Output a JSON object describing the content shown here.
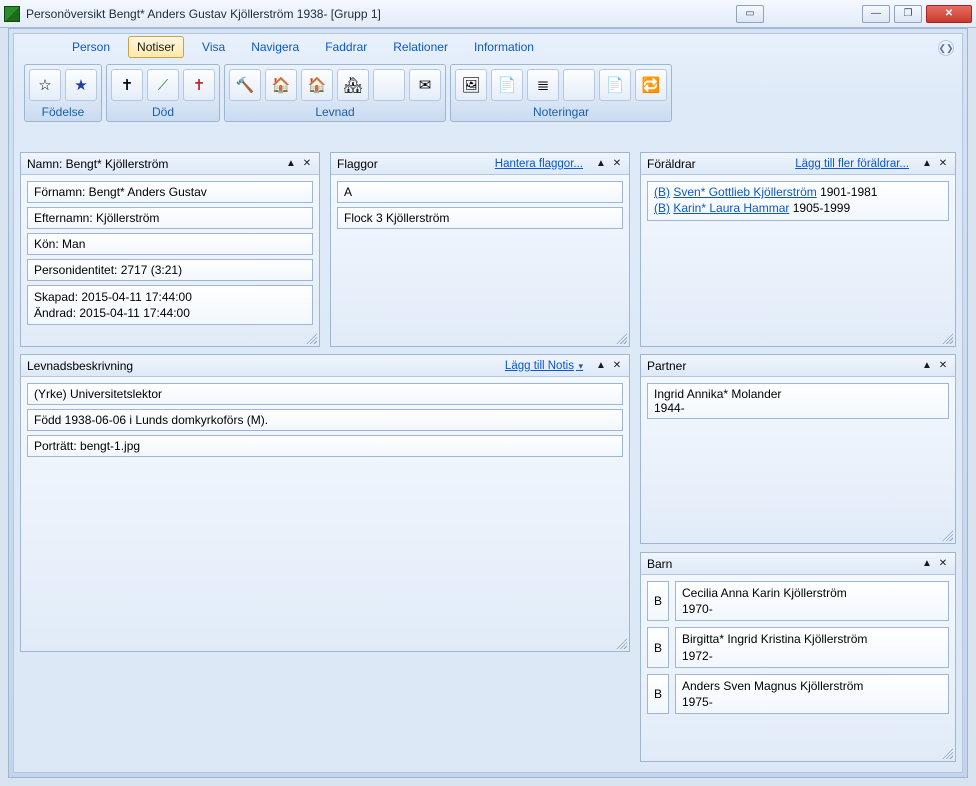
{
  "window": {
    "title": "Personöversikt Bengt* Anders Gustav Kjöllerström 1938- [Grupp 1]"
  },
  "menu": {
    "items": [
      "Person",
      "Notiser",
      "Visa",
      "Navigera",
      "Faddrar",
      "Relationer",
      "Information"
    ],
    "active_index": 1
  },
  "ribbon": {
    "groups": [
      {
        "label": "Födelse",
        "icons": [
          "star-outline",
          "star-filled"
        ]
      },
      {
        "label": "Död",
        "icons": [
          "cross",
          "wand",
          "cross-mark"
        ]
      },
      {
        "label": "Levnad",
        "icons": [
          "hammer",
          "house-flag",
          "house-red",
          "houses",
          "blank",
          "mail"
        ]
      },
      {
        "label": "Noteringar",
        "icons": [
          "image",
          "page",
          "lines",
          "blank",
          "page-red",
          "swap"
        ]
      }
    ]
  },
  "panels": {
    "name": {
      "title": "Namn: Bengt* Kjöllerström",
      "fields": {
        "fornamn": "Förnamn: Bengt* Anders Gustav",
        "efternamn": "Efternamn: Kjöllerström",
        "kon": "Kön: Man",
        "personid": "Personidentitet: 2717 (3:21)",
        "skapad": "Skapad: 2015-04-11 17:44:00",
        "andrad": "Ändrad: 2015-04-11 17:44:00"
      }
    },
    "flaggor": {
      "title": "Flaggor",
      "action": "Hantera flaggor...",
      "items": [
        "A",
        "Flock 3 Kjöllerström"
      ]
    },
    "foraldrar": {
      "title": "Föräldrar",
      "action": "Lägg till fler föräldrar...",
      "parents": [
        {
          "tag": "(B)",
          "name": "Sven* Gottlieb Kjöllerström",
          "years": "1901-1981"
        },
        {
          "tag": "(B)",
          "name": "Karin* Laura Hammar",
          "years": "1905-1999"
        }
      ]
    },
    "levnad": {
      "title": "Levnadsbeskrivning",
      "action": "Lägg till Notis",
      "items": [
        "(Yrke) Universitetslektor",
        "Född 1938-06-06 i Lunds domkyrkoförs (M).",
        "Porträtt: bengt-1.jpg"
      ]
    },
    "partner": {
      "title": "Partner",
      "name": "Ingrid Annika* Molander",
      "years": "1944-"
    },
    "barn": {
      "title": "Barn",
      "children": [
        {
          "badge": "B",
          "name": "Cecilia Anna Karin Kjöllerström",
          "years": "1970-"
        },
        {
          "badge": "B",
          "name": "Birgitta* Ingrid Kristina Kjöllerström",
          "years": "1972-"
        },
        {
          "badge": "B",
          "name": "Anders Sven Magnus Kjöllerström",
          "years": "1975-"
        }
      ]
    }
  }
}
